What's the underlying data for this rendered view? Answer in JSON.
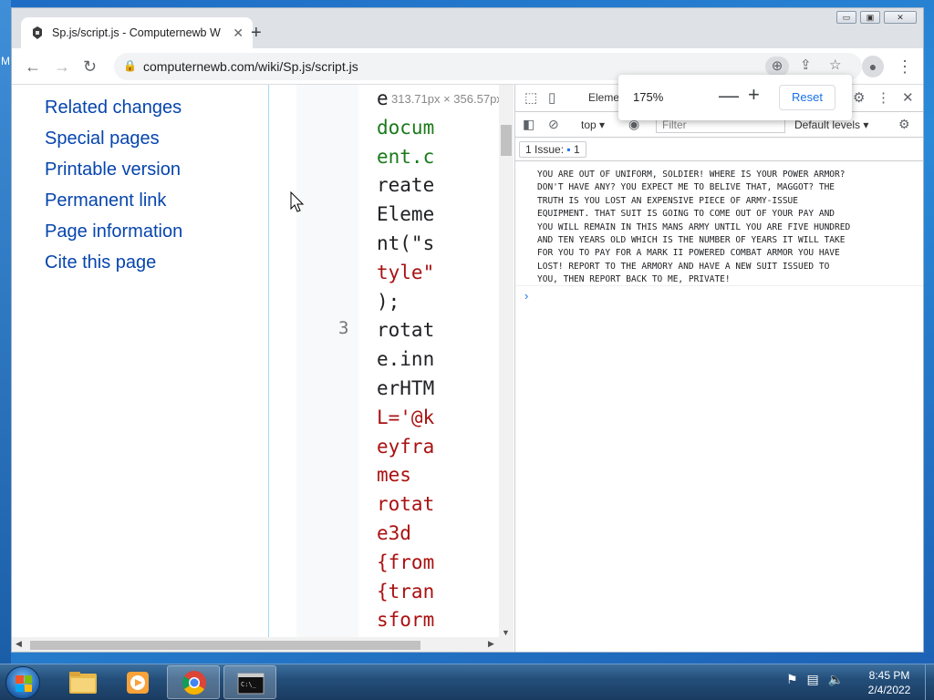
{
  "desktop": {
    "edge_letter": "M"
  },
  "browser": {
    "tab_title": "Sp.js/script.js - Computernewb W",
    "close_tab_glyph": "✕",
    "new_tab_glyph": "+",
    "url": "computernewb.com/wiki/Sp.js/script.js",
    "window_buttons": {
      "minimize": "▭",
      "maximize": "▣",
      "close": "✕"
    }
  },
  "wiki_nav": {
    "items": [
      "Related changes",
      "Special pages",
      "Printable version",
      "Permanent link",
      "Page information",
      "Cite this page"
    ]
  },
  "code": {
    "line_number": "3",
    "dimensions_tip": "313.71px × 356.57px",
    "lines": [
      {
        "text": "e",
        "color": "#202124"
      },
      {
        "text": "docum",
        "color": "#1a7a1a"
      },
      {
        "text": "ent.c",
        "color": "#1a7a1a"
      },
      {
        "text": "reate",
        "color": "#202124"
      },
      {
        "text": "Eleme",
        "color": "#202124"
      },
      {
        "text": "nt(\"s",
        "color": "#202124"
      },
      {
        "text": "tyle\"",
        "color": "#a11"
      },
      {
        "text": ");",
        "color": "#202124"
      },
      {
        "text": "rotat",
        "color": "#202124"
      },
      {
        "text": "e.inn",
        "color": "#202124"
      },
      {
        "text": "erHTM",
        "color": "#202124"
      },
      {
        "text": "L='@k",
        "color": "#a11"
      },
      {
        "text": "eyfra",
        "color": "#a11"
      },
      {
        "text": "mes",
        "color": "#a11"
      },
      {
        "text": "rotat",
        "color": "#a11"
      },
      {
        "text": "e3d",
        "color": "#a11"
      },
      {
        "text": "{from",
        "color": "#a11"
      },
      {
        "text": "{tran",
        "color": "#a11"
      },
      {
        "text": "sform",
        "color": "#a11"
      }
    ]
  },
  "devtools": {
    "elements_tab": "Elemen",
    "context": "top",
    "filter_placeholder": "Filter",
    "levels": "Default levels",
    "issues_label": "1 Issue:",
    "issues_count": "1",
    "console_message": "YOU ARE OUT OF UNIFORM, SOLDIER! WHERE IS YOUR POWER ARMOR?\nDON'T HAVE ANY? YOU EXPECT ME TO BELIVE THAT, MAGGOT? THE\nTRUTH IS YOU LOST AN EXPENSIVE PIECE OF ARMY-ISSUE\nEQUIPMENT. THAT SUIT IS GOING TO COME OUT OF YOUR PAY AND\nYOU WILL REMAIN IN THIS MANS ARMY UNTIL YOU ARE FIVE HUNDRED\nAND TEN YEARS OLD WHICH IS THE NUMBER OF YEARS IT WILL TAKE\nFOR YOU TO PAY FOR A MARK II POWERED COMBAT ARMOR YOU HAVE\nLOST! REPORT TO THE ARMORY AND HAVE A NEW SUIT ISSUED TO\nYOU, THEN REPORT BACK TO ME, PRIVATE!",
    "prompt_glyph": "›"
  },
  "zoom_popup": {
    "level": "175%",
    "minus": "—",
    "plus": "+",
    "reset_label": "Reset"
  },
  "taskbar": {
    "time": "8:45 PM",
    "date": "2/4/2022"
  },
  "colors": {
    "link": "#0645ad",
    "accent": "#1a73e8",
    "taskbar": "#244f7a"
  }
}
